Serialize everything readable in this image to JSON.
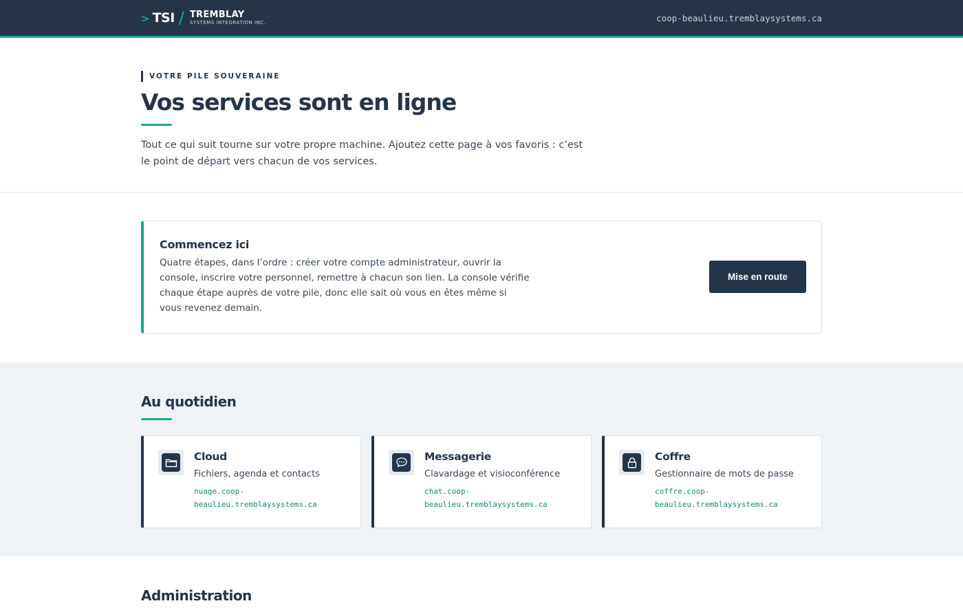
{
  "header": {
    "brand_chevron": ">",
    "brand_short": "TSI",
    "brand_slash": "/",
    "brand_name": "TREMBLAY",
    "brand_sub": "SYSTEMS INTEGRATION INC.",
    "host": "coop-beaulieu.tremblaysystems.ca"
  },
  "hero": {
    "eyebrow": "VOTRE PILE SOUVERAINE",
    "title": "Vos services sont en ligne",
    "intro": "Tout ce qui suit tourne sur votre propre machine. Ajoutez cette page à vos favoris : c’est le point de départ vers chacun de vos services."
  },
  "start": {
    "title": "Commencez ici",
    "text": "Quatre étapes, dans l’ordre : créer votre compte administrateur, ouvrir la console, inscrire votre personnel, remettre à chacun son lien. La console vérifie chaque étape auprès de votre pile, donc elle sait où vous en êtes même si vous revenez demain.",
    "button_label": "Mise en route"
  },
  "daily": {
    "title": "Au quotidien",
    "cards": [
      {
        "icon": "folder-icon",
        "title": "Cloud",
        "desc": "Fichiers, agenda et contacts",
        "url": "nuage.coop-beaulieu.tremblaysystems.ca"
      },
      {
        "icon": "chat-bubble-icon",
        "title": "Messagerie",
        "desc": "Clavardage et visioconférence",
        "url": "chat.coop-beaulieu.tremblaysystems.ca"
      },
      {
        "icon": "lock-icon",
        "title": "Coffre",
        "desc": "Gestionnaire de mots de passe",
        "url": "coffre.coop-beaulieu.tremblaysystems.ca"
      }
    ]
  },
  "admin": {
    "title": "Administration"
  },
  "colors": {
    "navy": "#253549",
    "accent": "#17a88c",
    "link": "#138a72",
    "section_bg": "#f0f3f6"
  }
}
